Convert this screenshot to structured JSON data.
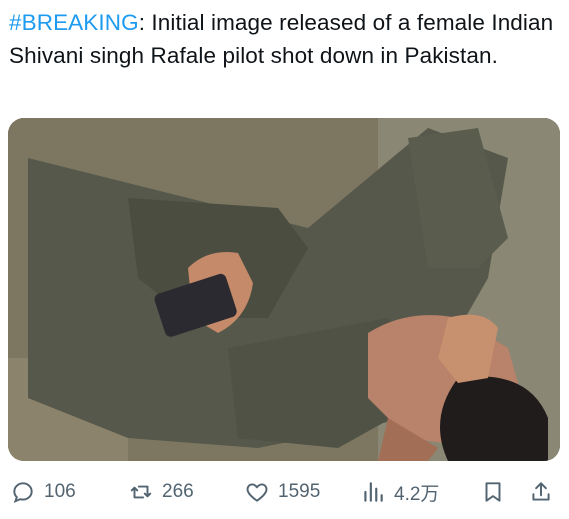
{
  "tweet": {
    "hashtag": "#BREAKING",
    "text_after_hashtag": ": Initial image released of a female Indian Shivani singh Rafale pilot shot down in Pakistan."
  },
  "media": {
    "description_icon": "photo"
  },
  "actions": {
    "replies": "106",
    "retweets": "266",
    "likes": "1595",
    "views": "4.2万"
  },
  "colors": {
    "hashtag": "#1d9bf0",
    "action_gray": "#536471"
  }
}
